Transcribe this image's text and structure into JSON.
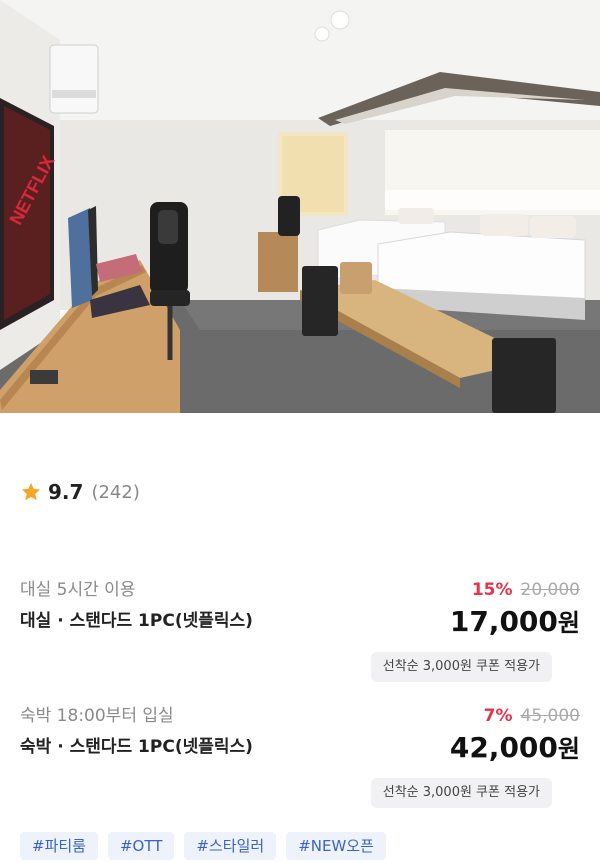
{
  "rating": {
    "score": "9.7",
    "count": "(242)",
    "star_color": "#f5a623"
  },
  "offers": [
    {
      "usage": "대실 5시간 이용",
      "room": "대실 · 스탠다드 1PC(넷플릭스)",
      "discount": "15%",
      "original_price": "20,000",
      "price": "17,000",
      "currency": "원",
      "coupon": "선착순 3,000원 쿠폰 적용가"
    },
    {
      "usage": "숙박 18:00부터 입실",
      "room": "숙박 · 스탠다드 1PC(넷플릭스)",
      "discount": "7%",
      "original_price": "45,000",
      "price": "42,000",
      "currency": "원",
      "coupon": "선착순 3,000원 쿠폰 적용가"
    }
  ],
  "tags": [
    "#파티룸",
    "#OTT",
    "#스타일러",
    "#NEW오픈"
  ],
  "colors": {
    "discount": "#e8324b",
    "tag_text": "#3b63c4",
    "tag_bg": "#eef2fb",
    "coupon_bg": "#f1f1f3"
  },
  "photo": {
    "tv_logo": "NETFLIX"
  }
}
